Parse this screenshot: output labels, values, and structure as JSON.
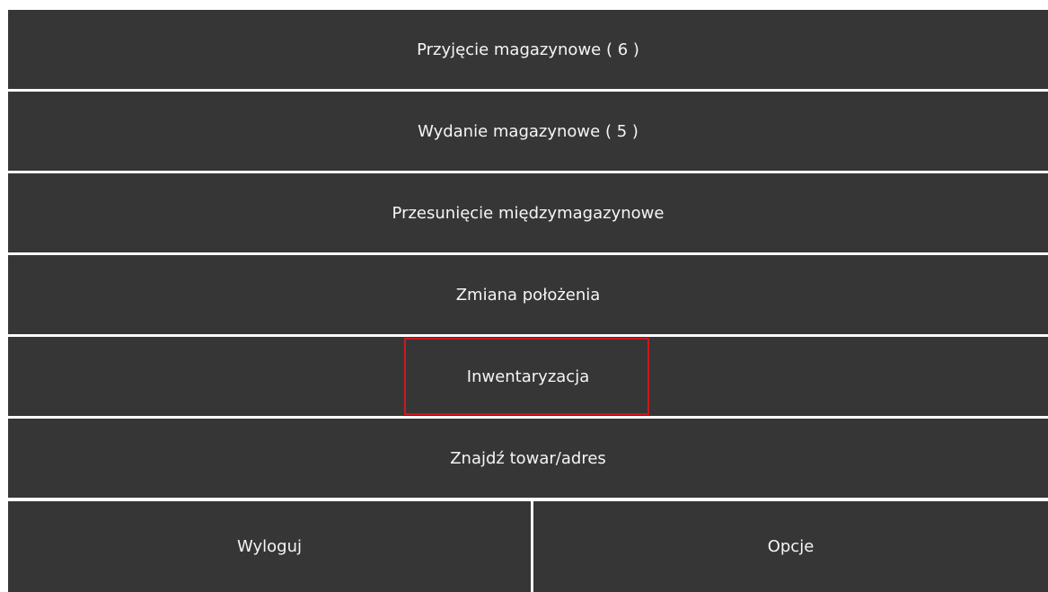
{
  "menu": {
    "items": [
      {
        "label": "Przyjęcie magazynowe ( 6 )"
      },
      {
        "label": "Wydanie magazynowe ( 5 )"
      },
      {
        "label": "Przesunięcie międzymagazynowe"
      },
      {
        "label": "Zmiana położenia"
      },
      {
        "label": "Inwentaryzacja"
      },
      {
        "label": "Znajdź towar/adres"
      }
    ]
  },
  "footer": {
    "logout_label": "Wyloguj",
    "options_label": "Opcje"
  },
  "colors": {
    "button_bg": "#363636",
    "button_text": "#f5f5f5",
    "highlight": "#d0161e",
    "background": "#ffffff"
  }
}
